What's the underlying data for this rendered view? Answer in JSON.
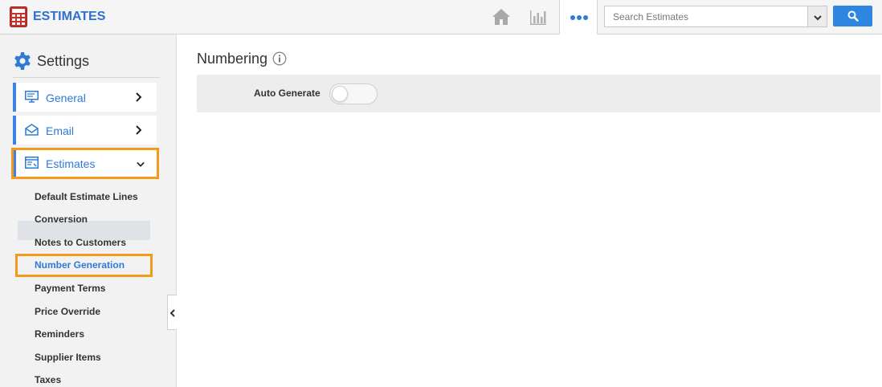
{
  "app": {
    "title": "ESTIMATES"
  },
  "search": {
    "placeholder": "Search Estimates"
  },
  "sidebar": {
    "title": "Settings",
    "items": [
      {
        "label": "General"
      },
      {
        "label": "Email"
      },
      {
        "label": "Estimates"
      }
    ],
    "sub_items": [
      "Default Estimate Lines",
      "Conversion",
      "Notes to Customers",
      "Number Generation",
      "Payment Terms",
      "Price Override",
      "Reminders",
      "Supplier Items",
      "Taxes"
    ],
    "active_sub_item": "Number Generation"
  },
  "main": {
    "title": "Numbering",
    "fields": [
      {
        "label": "Auto Generate",
        "enabled": false
      }
    ]
  },
  "colors": {
    "accent": "#2e7bd6",
    "highlight": "#f39a1a",
    "search_button": "#2f86e0"
  }
}
